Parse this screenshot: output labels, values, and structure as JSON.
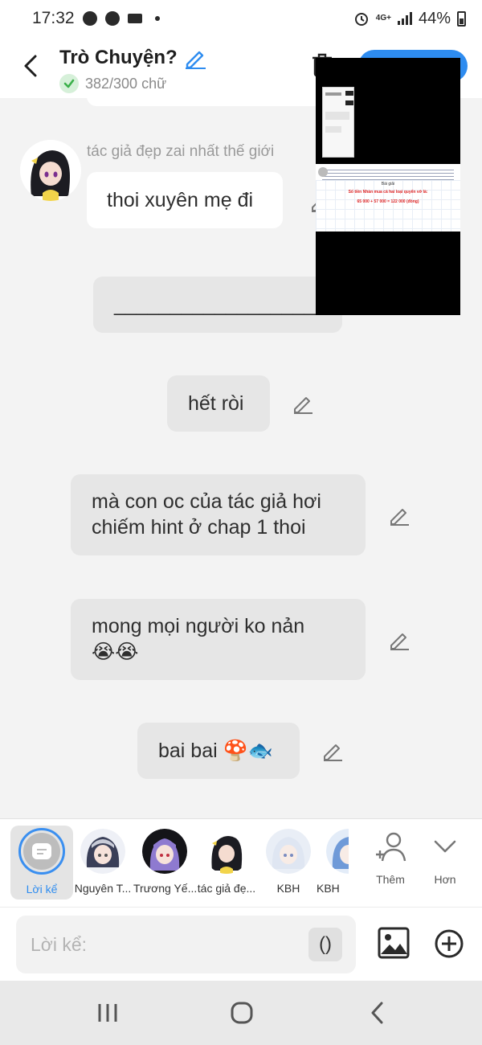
{
  "status_bar": {
    "time": "17:32",
    "network": "4G+",
    "battery": "44%",
    "icons": [
      "messenger-icon",
      "messenger-icon",
      "video-icon",
      "dot-icon",
      "alarm-icon",
      "signal-icon",
      "battery-icon"
    ]
  },
  "header": {
    "title": "Trò Chuyện?",
    "count": "382/300 chữ",
    "accent_color": "#2e8cf0"
  },
  "chat": {
    "speaker_name": "tác giả đẹp zai nhất thế giới",
    "messages": [
      {
        "text": "thoi xuyên mẹ đi"
      },
      {
        "text": "______________________"
      },
      {
        "text": "hết ròi"
      },
      {
        "line1": "mà con oc của tác giả hơi",
        "line2": "chiếm hint ở chap 1 thoi"
      },
      {
        "line1": "mong mọi người ko nản",
        "line2": "😭😭"
      },
      {
        "text": "bai bai 🍄🐟"
      }
    ]
  },
  "overlay": {
    "line1": "Bài giải",
    "line2": "Số tiền Nhàn mua cả hai loại quyển vở là:",
    "line3": "65 000 + 57 000 = 122 000 (đồng)"
  },
  "characters": [
    {
      "label": "Lời kể"
    },
    {
      "label": "Nguyên T..."
    },
    {
      "label": "Trương Yế..."
    },
    {
      "label": "tác giả đẹ..."
    },
    {
      "label": "KBH"
    },
    {
      "label": "KBH"
    }
  ],
  "tools": {
    "add_label": "Thêm",
    "more_label": "Hơn"
  },
  "input": {
    "placeholder": "Lời kể:",
    "paren_label": "()"
  }
}
